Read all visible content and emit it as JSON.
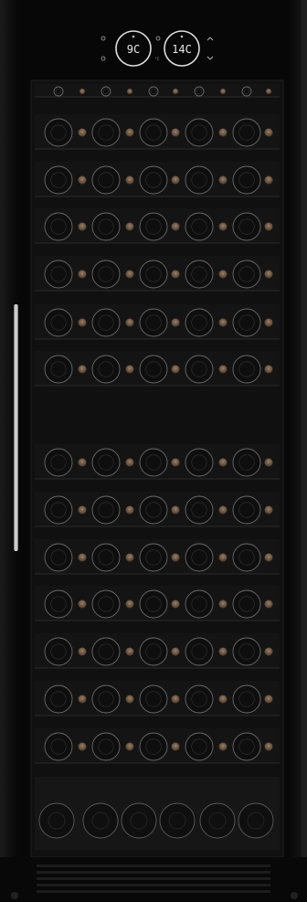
{
  "appliance": {
    "type": "wine cooler",
    "body_color": "#0b0b0b",
    "glass_color": "#121212",
    "handle_color": "#c9c9c9"
  },
  "display": {
    "left_zone_temp": "9C",
    "right_zone_temp": "14C",
    "left_zone_label": "°C",
    "right_zone_label": "°C"
  },
  "shelves": {
    "count": 15,
    "empty_gap_after": 7
  }
}
